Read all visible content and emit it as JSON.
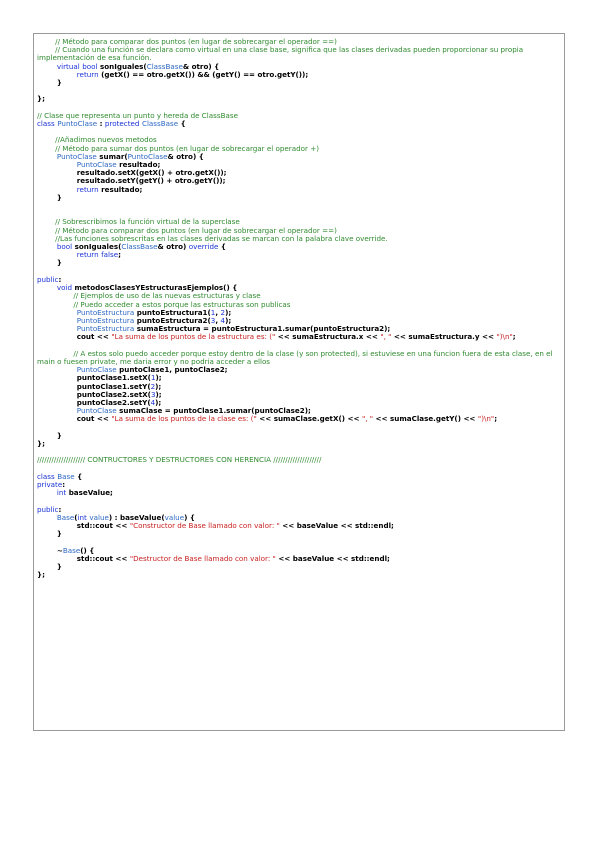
{
  "colors": {
    "keyword": "#1a32d6",
    "type": "#2c68c4",
    "comment": "#2f8a2f",
    "string": "#c82020",
    "number": "#1a32d6",
    "plain": "#000000",
    "border": "#9a9a9a"
  },
  "code_lines": [
    [
      [
        "cm",
        "        // Método para comparar dos puntos (en lugar de sobrecargar el operador ==)"
      ]
    ],
    [
      [
        "cm",
        "        // Cuando una función se declara como virtual en una clase base, significa que las clases derivadas pueden proporcionar su propia implementación de esa función."
      ]
    ],
    [
      [
        "pl",
        "        "
      ],
      [
        "kw",
        "virtual"
      ],
      [
        "pl",
        " "
      ],
      [
        "kw",
        "bool"
      ],
      [
        "pl",
        " sonIguales("
      ],
      [
        "ty",
        "ClassBase"
      ],
      [
        "pl",
        "& otro) {"
      ]
    ],
    [
      [
        "pl",
        "                "
      ],
      [
        "kw",
        "return"
      ],
      [
        "pl",
        " (getX() == otro.getX()) && (getY() == otro.getY());"
      ]
    ],
    [
      [
        "pl",
        "        }"
      ]
    ],
    [
      [
        "pl",
        ""
      ]
    ],
    [
      [
        "pl",
        "};"
      ]
    ],
    [
      [
        "pl",
        ""
      ]
    ],
    [
      [
        "cm",
        "// Clase que representa un punto y hereda de ClassBase"
      ]
    ],
    [
      [
        "kw",
        "class"
      ],
      [
        "pl",
        " "
      ],
      [
        "ty",
        "PuntoClase"
      ],
      [
        "pl",
        " : "
      ],
      [
        "kw",
        "protected"
      ],
      [
        "pl",
        " "
      ],
      [
        "ty",
        "ClassBase"
      ],
      [
        "pl",
        " {"
      ]
    ],
    [
      [
        "pl",
        ""
      ]
    ],
    [
      [
        "cm",
        "        //Añadimos nuevos metodos"
      ]
    ],
    [
      [
        "cm",
        "        // Método para sumar dos puntos (en lugar de sobrecargar el operador +)"
      ]
    ],
    [
      [
        "pl",
        "        "
      ],
      [
        "ty",
        "PuntoClase"
      ],
      [
        "pl",
        " sumar("
      ],
      [
        "ty",
        "PuntoClase"
      ],
      [
        "pl",
        "& otro) {"
      ]
    ],
    [
      [
        "pl",
        "                "
      ],
      [
        "ty",
        "PuntoClase"
      ],
      [
        "pl",
        " resultado;"
      ]
    ],
    [
      [
        "pl",
        "                resultado.setX(getX() + otro.getX());"
      ]
    ],
    [
      [
        "pl",
        "                resultado.setY(getY() + otro.getY());"
      ]
    ],
    [
      [
        "pl",
        "                "
      ],
      [
        "kw",
        "return"
      ],
      [
        "pl",
        " resultado;"
      ]
    ],
    [
      [
        "pl",
        "        }"
      ]
    ],
    [
      [
        "pl",
        ""
      ]
    ],
    [
      [
        "pl",
        ""
      ]
    ],
    [
      [
        "cm",
        "        // Sobrescribimos la función virtual de la superclase"
      ]
    ],
    [
      [
        "cm",
        "        // Método para comparar dos puntos (en lugar de sobrecargar el operador ==)"
      ]
    ],
    [
      [
        "cm",
        "        //Las funciones sobrescritas en las clases derivadas se marcan con la palabra clave override."
      ]
    ],
    [
      [
        "pl",
        "        "
      ],
      [
        "kw",
        "bool"
      ],
      [
        "pl",
        " sonIguales("
      ],
      [
        "ty",
        "ClassBase"
      ],
      [
        "pl",
        "& otro) "
      ],
      [
        "kw",
        "override"
      ],
      [
        "pl",
        " {"
      ]
    ],
    [
      [
        "pl",
        "                "
      ],
      [
        "kw",
        "return"
      ],
      [
        "pl",
        " "
      ],
      [
        "kw",
        "false"
      ],
      [
        "pl",
        ";"
      ]
    ],
    [
      [
        "pl",
        "        }"
      ]
    ],
    [
      [
        "pl",
        ""
      ]
    ],
    [
      [
        "kw",
        "public"
      ],
      [
        "pl",
        ":"
      ]
    ],
    [
      [
        "pl",
        "        "
      ],
      [
        "kw",
        "void"
      ],
      [
        "pl",
        " metodosClasesYEstructurasEjemplos() {"
      ]
    ],
    [
      [
        "cm",
        "                // Ejemplos de uso de las nuevas estructuras y clase"
      ]
    ],
    [
      [
        "cm",
        "                // Puedo acceder a estos porque las estructuras son publicas"
      ]
    ],
    [
      [
        "pl",
        "                "
      ],
      [
        "ty",
        "PuntoEstructura"
      ],
      [
        "pl",
        " puntoEstructura1("
      ],
      [
        "nm",
        "1"
      ],
      [
        "pl",
        ", "
      ],
      [
        "nm",
        "2"
      ],
      [
        "pl",
        ");"
      ]
    ],
    [
      [
        "pl",
        "                "
      ],
      [
        "ty",
        "PuntoEstructura"
      ],
      [
        "pl",
        " puntoEstructura2("
      ],
      [
        "nm",
        "3"
      ],
      [
        "pl",
        ", "
      ],
      [
        "nm",
        "4"
      ],
      [
        "pl",
        ");"
      ]
    ],
    [
      [
        "pl",
        "                "
      ],
      [
        "ty",
        "PuntoEstructura"
      ],
      [
        "pl",
        " sumaEstructura = puntoEstructura1.sumar(puntoEstructura2);"
      ]
    ],
    [
      [
        "pl",
        "                cout << "
      ],
      [
        "st",
        "\"La suma de los puntos de la estructura es: (\""
      ],
      [
        "pl",
        " << sumaEstructura.x << "
      ],
      [
        "st",
        "\", \""
      ],
      [
        "pl",
        " << sumaEstructura.y << "
      ],
      [
        "st",
        "\")\\n\""
      ],
      [
        "pl",
        ";"
      ]
    ],
    [
      [
        "pl",
        ""
      ]
    ],
    [
      [
        "cm",
        "                // A estos solo puedo acceder porque estoy dentro de la clase (y son protected), si estuviese en una funcion fuera de esta clase, en el main o fuesen private, me daria error y no podria acceder a ellos"
      ]
    ],
    [
      [
        "pl",
        "                "
      ],
      [
        "ty",
        "PuntoClase"
      ],
      [
        "pl",
        " puntoClase1, puntoClase2;"
      ]
    ],
    [
      [
        "pl",
        "                puntoClase1.setX("
      ],
      [
        "nm",
        "1"
      ],
      [
        "pl",
        ");"
      ]
    ],
    [
      [
        "pl",
        "                puntoClase1.setY("
      ],
      [
        "nm",
        "2"
      ],
      [
        "pl",
        ");"
      ]
    ],
    [
      [
        "pl",
        "                puntoClase2.setX("
      ],
      [
        "nm",
        "3"
      ],
      [
        "pl",
        ");"
      ]
    ],
    [
      [
        "pl",
        "                puntoClase2.setY("
      ],
      [
        "nm",
        "4"
      ],
      [
        "pl",
        ");"
      ]
    ],
    [
      [
        "pl",
        "                "
      ],
      [
        "ty",
        "PuntoClase"
      ],
      [
        "pl",
        " sumaClase = puntoClase1.sumar(puntoClase2);"
      ]
    ],
    [
      [
        "pl",
        "                cout << "
      ],
      [
        "st",
        "\"La suma de los puntos de la clase es: (\""
      ],
      [
        "pl",
        " << sumaClase.getX() << "
      ],
      [
        "st",
        "\", \""
      ],
      [
        "pl",
        " << sumaClase.getY() << "
      ],
      [
        "st",
        "\")\\n\""
      ],
      [
        "pl",
        ";"
      ]
    ],
    [
      [
        "pl",
        ""
      ]
    ],
    [
      [
        "pl",
        "        }"
      ]
    ],
    [
      [
        "pl",
        "};"
      ]
    ],
    [
      [
        "pl",
        ""
      ]
    ],
    [
      [
        "cm",
        "//////////////////// CONTRUCTORES Y DESTRUCTORES CON HERENCIA ////////////////////"
      ]
    ],
    [
      [
        "pl",
        ""
      ]
    ],
    [
      [
        "kw",
        "class"
      ],
      [
        "pl",
        " "
      ],
      [
        "ty",
        "Base"
      ],
      [
        "pl",
        " {"
      ]
    ],
    [
      [
        "kw",
        "private"
      ],
      [
        "pl",
        ":"
      ]
    ],
    [
      [
        "pl",
        "        "
      ],
      [
        "kw",
        "int"
      ],
      [
        "pl",
        " baseValue;"
      ]
    ],
    [
      [
        "pl",
        ""
      ]
    ],
    [
      [
        "kw",
        "public"
      ],
      [
        "pl",
        ":"
      ]
    ],
    [
      [
        "pl",
        "        "
      ],
      [
        "ty",
        "Base"
      ],
      [
        "pl",
        "("
      ],
      [
        "kw",
        "int"
      ],
      [
        "pl",
        " "
      ],
      [
        "ty",
        "value"
      ],
      [
        "pl",
        ") : baseValue("
      ],
      [
        "ty",
        "value"
      ],
      [
        "pl",
        ") {"
      ]
    ],
    [
      [
        "pl",
        "                std::cout << "
      ],
      [
        "st",
        "\"Constructor de Base llamado con valor: \""
      ],
      [
        "pl",
        " << baseValue << std::endl;"
      ]
    ],
    [
      [
        "pl",
        "        }"
      ]
    ],
    [
      [
        "pl",
        ""
      ]
    ],
    [
      [
        "pl",
        "        ~"
      ],
      [
        "ty",
        "Base"
      ],
      [
        "pl",
        "() {"
      ]
    ],
    [
      [
        "pl",
        "                std::cout << "
      ],
      [
        "st",
        "\"Destructor de Base llamado con valor: \""
      ],
      [
        "pl",
        " << baseValue << std::endl;"
      ]
    ],
    [
      [
        "pl",
        "        }"
      ]
    ],
    [
      [
        "pl",
        "};"
      ]
    ]
  ]
}
